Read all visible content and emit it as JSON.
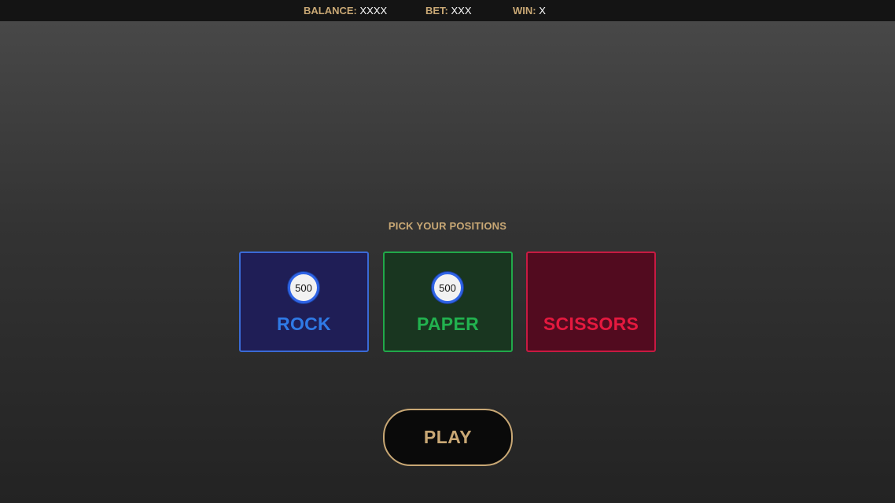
{
  "header": {
    "balance": {
      "label": "BALANCE:",
      "value": "XXXX"
    },
    "bet": {
      "label": "BET:",
      "value": "XXX"
    },
    "win": {
      "label": "WIN:",
      "value": "X"
    }
  },
  "prompt": "PICK YOUR POSITIONS",
  "positions": [
    {
      "label": "ROCK",
      "chip": "500"
    },
    {
      "label": "PAPER",
      "chip": "500"
    },
    {
      "label": "SCISSORS",
      "chip": null
    }
  ],
  "play_label": "PLAY",
  "colors": {
    "accent": "#c9a875",
    "rock": "#2f7ae6",
    "paper": "#22b24f",
    "scissors": "#e5193f",
    "chip_ring": "#2f64e6"
  }
}
